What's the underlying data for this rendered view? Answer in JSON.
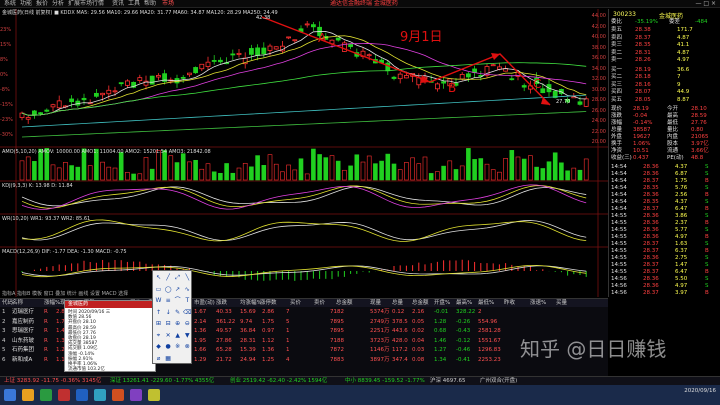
{
  "menu": {
    "items": [
      "系统",
      "功能",
      "报价",
      "分析",
      "扩展市场行情",
      "资讯",
      "工具",
      "帮助"
    ],
    "alert": "市场",
    "center_title": "通达信金融终端 金城医药",
    "winctl": "— □ ×"
  },
  "main_chart": {
    "legend": "金城医药(日线 前复权) ■ KDDX MA5: 29.56 MA10: 29.66 MA20: 31.77 MA60: 34.87 MA120: 28.29 MA250: 24.49",
    "annotations": {
      "A": "A",
      "B": "B",
      "C": "C",
      "date": "9月1日"
    },
    "high_label": "42.38",
    "low_label": "27.70",
    "y_ticks": [
      "44.00",
      "42.00",
      "40.00",
      "38.00",
      "36.00",
      "34.00",
      "32.00",
      "30.00",
      "28.00",
      "26.00",
      "24.00",
      "22.00",
      "20.00"
    ],
    "left_ticks": [
      "23%",
      "15%",
      "8%",
      "0%",
      "-8%",
      "-15%",
      "-23%",
      "-30%"
    ]
  },
  "volume_panel": {
    "legend": "AMO(5,10,20) AMOV: 10000.00 AMO1: 11004.00 AMO2: 15201.54 AMO3: 21842.08",
    "ticks": [
      "3.00",
      "2.00",
      "1.00"
    ]
  },
  "kdj_panel": {
    "legend": "KDJ(9,3,3) K: 13.98 D: 11.84",
    "ticks": [
      "80",
      "50",
      "20"
    ]
  },
  "wr_panel": {
    "legend": "WR(10,20) WR1: 93.37 WR2: 85.61",
    "ticks": [
      "100",
      "50",
      "0"
    ]
  },
  "macd_panel": {
    "legend": "MACD(12,26,9) DIF: -1.77 DEA: -1.30 MACD: -0.75",
    "ticks": [
      "2.00",
      "0.00",
      "-2.00"
    ]
  },
  "chart_tabs": "指标A 指标B 模板 窗口 叠加 统计 画线 设置 MACD 选择",
  "quote": {
    "code": "300233",
    "name": "金城医药",
    "ratio_label": "委比",
    "ratio_value": "-35.19%",
    "diff_label": "委差",
    "diff_value": "-484",
    "sells": [
      {
        "label": "卖五",
        "price": "28.38",
        "vol": "171.7"
      },
      {
        "label": "卖四",
        "price": "28.37",
        "vol": "4.87"
      },
      {
        "label": "卖三",
        "price": "28.35",
        "vol": "41.1"
      },
      {
        "label": "卖二",
        "price": "28.31",
        "vol": "4.87"
      },
      {
        "label": "卖一",
        "price": "28.26",
        "vol": "4.97"
      }
    ],
    "buys": [
      {
        "label": "买一",
        "price": "28.19",
        "vol": "36.6"
      },
      {
        "label": "买二",
        "price": "28.18",
        "vol": "7"
      },
      {
        "label": "买三",
        "price": "28.16",
        "vol": "9"
      },
      {
        "label": "买四",
        "price": "28.07",
        "vol": "44.9"
      },
      {
        "label": "买五",
        "price": "28.05",
        "vol": "8.87"
      }
    ],
    "stats": [
      {
        "k": "现价",
        "v": "28.19",
        "k2": "今开",
        "v2": "28.10"
      },
      {
        "k": "涨跌",
        "v": "-0.04",
        "k2": "最高",
        "v2": "28.59"
      },
      {
        "k": "涨幅",
        "v": "-0.14%",
        "k2": "最低",
        "v2": "27.76"
      },
      {
        "k": "总量",
        "v": "38587",
        "k2": "量比",
        "v2": "0.80"
      },
      {
        "k": "外盘",
        "v": "19627",
        "k2": "内盘",
        "v2": "21065"
      },
      {
        "k": "换手",
        "v": "1.06%",
        "k2": "股本",
        "v2": "3.97亿"
      },
      {
        "k": "净资",
        "v": "10.51",
        "k2": "流通",
        "v2": "3.66亿"
      },
      {
        "k": "收益(三)",
        "v": "0.437",
        "k2": "PE(动)",
        "v2": "48.8"
      }
    ],
    "ticks": [
      {
        "t": "14:54",
        "p": "28.36",
        "v": "4.37",
        "f": "S"
      },
      {
        "t": "14:54",
        "p": "28.36",
        "v": "6.87",
        "f": "S"
      },
      {
        "t": "14:54",
        "p": "28.37",
        "v": "1.75",
        "f": "B"
      },
      {
        "t": "14:54",
        "p": "28.35",
        "v": "5.76",
        "f": "S"
      },
      {
        "t": "14:54",
        "p": "28.36",
        "v": "2.56",
        "f": "B"
      },
      {
        "t": "14:54",
        "p": "28.35",
        "v": "4.37",
        "f": "S"
      },
      {
        "t": "14:54",
        "p": "28.37",
        "v": "6.47",
        "f": "B"
      },
      {
        "t": "14:55",
        "p": "28.36",
        "v": "3.86",
        "f": "S"
      },
      {
        "t": "14:55",
        "p": "28.36",
        "v": "2.37",
        "f": "B"
      },
      {
        "t": "14:55",
        "p": "28.36",
        "v": "5.77",
        "f": "S"
      },
      {
        "t": "14:55",
        "p": "28.36",
        "v": "4.97",
        "f": "B"
      },
      {
        "t": "14:55",
        "p": "28.37",
        "v": "1.63",
        "f": "S"
      },
      {
        "t": "14:55",
        "p": "28.37",
        "v": "6.37",
        "f": "B"
      },
      {
        "t": "14:55",
        "p": "28.36",
        "v": "2.75",
        "f": "S"
      },
      {
        "t": "14:55",
        "p": "28.37",
        "v": "1.47",
        "f": "S"
      },
      {
        "t": "14:55",
        "p": "28.37",
        "v": "6.47",
        "f": "B"
      },
      {
        "t": "14:56",
        "p": "28.36",
        "v": "5.50",
        "f": "S"
      },
      {
        "t": "14:56",
        "p": "28.36",
        "v": "4.97",
        "f": "S"
      },
      {
        "t": "14:56",
        "p": "28.37",
        "v": "3.97",
        "f": "B"
      },
      {
        "t": "14:56",
        "p": "28.36",
        "v": "6.72",
        "f": "S"
      },
      {
        "t": "14:56",
        "p": "28.36",
        "v": "9.55",
        "f": "S"
      },
      {
        "t": "14:56",
        "p": "28.36",
        "v": "4.37",
        "f": "S"
      },
      {
        "t": "14:56",
        "p": "28.37",
        "v": "6.57",
        "f": "B"
      },
      {
        "t": "14:56",
        "p": "28.36",
        "v": "1.86",
        "f": "S"
      },
      {
        "t": "14:56",
        "p": "28.37",
        "v": "6.47",
        "f": "B"
      },
      {
        "t": "14:56",
        "p": "28.37",
        "v": "4.86",
        "f": "S"
      },
      {
        "t": "14:56",
        "p": "28.37",
        "v": "2.56",
        "f": "S"
      },
      {
        "t": "14:56",
        "p": "28.36",
        "v": "3.57",
        "f": "S"
      },
      {
        "t": "14:56",
        "p": "28.36",
        "v": "8.87",
        "f": "S"
      },
      {
        "t": "14:56",
        "p": "28.37",
        "v": "1.17",
        "f": "B"
      },
      {
        "t": "14:57",
        "p": "28.37",
        "v": "10.00",
        "f": "S"
      },
      {
        "t": "14:57",
        "p": "28.36",
        "v": "6.87",
        "f": "S"
      }
    ]
  },
  "table": {
    "headers": [
      "代码",
      "名称",
      "涨幅%",
      "现价",
      "涨跌",
      "买价",
      "卖价",
      "换手%",
      "市盈(动)",
      "涨跌",
      "均涨幅%",
      "涨停数",
      "买价",
      "卖价",
      "总金额",
      "现量",
      "总量",
      "总金额",
      "开盘%",
      "最高%",
      "最低%",
      "昨收",
      "涨速%",
      "买量"
    ],
    "rows": [
      [
        "1",
        "迈瑞医疗",
        "R",
        "2.85",
        "",
        "1.67",
        "40.33",
        "15.69",
        "2.86",
        "7",
        "",
        "",
        "7182",
        "",
        "5374万",
        "0.12",
        "2.16",
        "-0.01",
        "328.22",
        "2"
      ],
      [
        "2",
        "嘉应制药",
        "R",
        "1.76",
        "",
        "2.14",
        "361.22",
        "9.74",
        "1.75",
        "5",
        "",
        "",
        "7895",
        "",
        "2749万",
        "378.5",
        "0.05",
        "1.28",
        "-0.26",
        "554.96"
      ],
      [
        "3",
        "思瑞医疗",
        "R",
        "1.46",
        "",
        "1.36",
        "49.57",
        "36.84",
        "0.97",
        "1",
        "",
        "",
        "7895",
        "",
        "2251万",
        "443.6",
        "0.02",
        "0.68",
        "-0.43",
        "2581.28"
      ],
      [
        "4",
        "山东药玻",
        "R",
        "1.31",
        "",
        "1.95",
        "27.86",
        "28.31",
        "1.12",
        "1",
        "",
        "",
        "7188",
        "",
        "3723万",
        "428.0",
        "0.04",
        "1.46",
        "-0.12",
        "1551.67"
      ],
      [
        "5",
        "石药集团",
        "R",
        "1.26",
        "",
        "1.66",
        "65.28",
        "15.39",
        "1.36",
        "1",
        "",
        "",
        "7872",
        "",
        "1146万",
        "117.2",
        "0.03",
        "1.27",
        "-0.46",
        "1296.83"
      ],
      [
        "6",
        "新和成A",
        "R",
        "1.13",
        "",
        "1.29",
        "21.72",
        "24.94",
        "1.25",
        "4",
        "",
        "",
        "7883",
        "",
        "3897万",
        "347.4",
        "0.08",
        "1.34",
        "-0.41",
        "2253.23"
      ]
    ]
  },
  "popup": {
    "title": "金城医药",
    "lines": [
      "时间 2020/09/16 三",
      "数值 28.56",
      "开盘价 28.10",
      "最高价 28.59",
      "最低价 27.76",
      "收盘价 28.19",
      "成交量 38587",
      "成交额 1.09亿",
      "涨幅 -0.14%",
      "振幅 2.91%",
      "换手率 1.06%",
      "流通市值 103.2亿"
    ]
  },
  "statusbar": {
    "items": [
      "上证 3283.92 -11.75 -0.36% 3145亿",
      "深证 13261.41 -229.60 -1.77% 4355亿",
      "创业 2519.42 -62.40 -2.42% 1594亿",
      "中小 8839.45 -159.52 -1.77%",
      "沪深 4697.65",
      "广州双合(开盘)"
    ]
  },
  "watermark": "知乎 @日日赚钱",
  "clock": {
    "time": "",
    "date": "2020/09/16"
  },
  "colors": {
    "up": "#ff4040",
    "down": "#20d020",
    "bg": "#000000",
    "annotation": "#ff2020"
  }
}
